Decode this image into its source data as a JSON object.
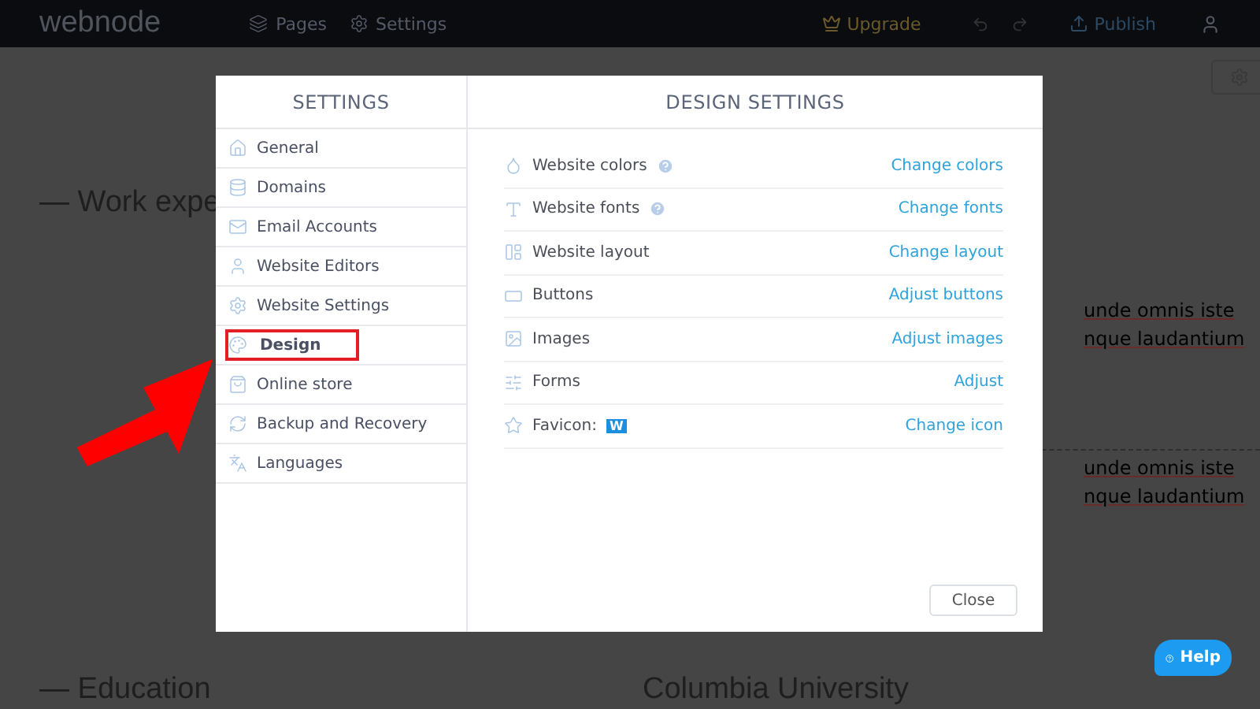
{
  "topbar": {
    "logo": "webnode",
    "nav": [
      {
        "label": "Pages",
        "kind": "pages"
      },
      {
        "label": "Settings",
        "kind": "settings"
      }
    ],
    "upgrade": "Upgrade",
    "publish": "Publish"
  },
  "background": {
    "heading_1": "— Work expe",
    "lines_1": [
      "unde omnis iste",
      "nque laudantium"
    ],
    "lines_2": [
      "unde omnis iste",
      "nque laudantium"
    ],
    "heading_2": "— Education",
    "heading_3": "Columbia University"
  },
  "dialog": {
    "sidebar_title": "SETTINGS",
    "main_title": "DESIGN SETTINGS",
    "sidebar_items": [
      {
        "label": "General",
        "kind": "home",
        "selected": false,
        "highlighted": false
      },
      {
        "label": "Domains",
        "kind": "domains",
        "selected": false,
        "highlighted": false
      },
      {
        "label": "Email Accounts",
        "kind": "mail",
        "selected": false,
        "highlighted": false
      },
      {
        "label": "Website Editors",
        "kind": "user",
        "selected": false,
        "highlighted": false
      },
      {
        "label": "Website Settings",
        "kind": "gear",
        "selected": false,
        "highlighted": false
      },
      {
        "label": "Design",
        "kind": "design",
        "selected": true,
        "highlighted": true
      },
      {
        "label": "Online store",
        "kind": "bag",
        "selected": false,
        "highlighted": false
      },
      {
        "label": "Backup and Recovery",
        "kind": "backup",
        "selected": false,
        "highlighted": false
      },
      {
        "label": "Languages",
        "kind": "languages",
        "selected": false,
        "highlighted": false
      }
    ],
    "settings": [
      {
        "label": "Website colors",
        "kind": "colors",
        "help": true,
        "action": "Change colors"
      },
      {
        "label": "Website fonts",
        "kind": "fonts",
        "help": true,
        "action": "Change fonts"
      },
      {
        "label": "Website layout",
        "kind": "layout",
        "help": false,
        "action": "Change layout"
      },
      {
        "label": "Buttons",
        "kind": "buttons",
        "help": false,
        "action": "Adjust buttons"
      },
      {
        "label": "Images",
        "kind": "images",
        "help": false,
        "action": "Adjust images"
      },
      {
        "label": "Forms",
        "kind": "forms",
        "help": false,
        "action": "Adjust"
      },
      {
        "label": "Favicon:",
        "kind": "favicon",
        "help": false,
        "favicon_letter": "W",
        "action": "Change icon"
      }
    ],
    "close": "Close"
  },
  "help_button": "Help"
}
